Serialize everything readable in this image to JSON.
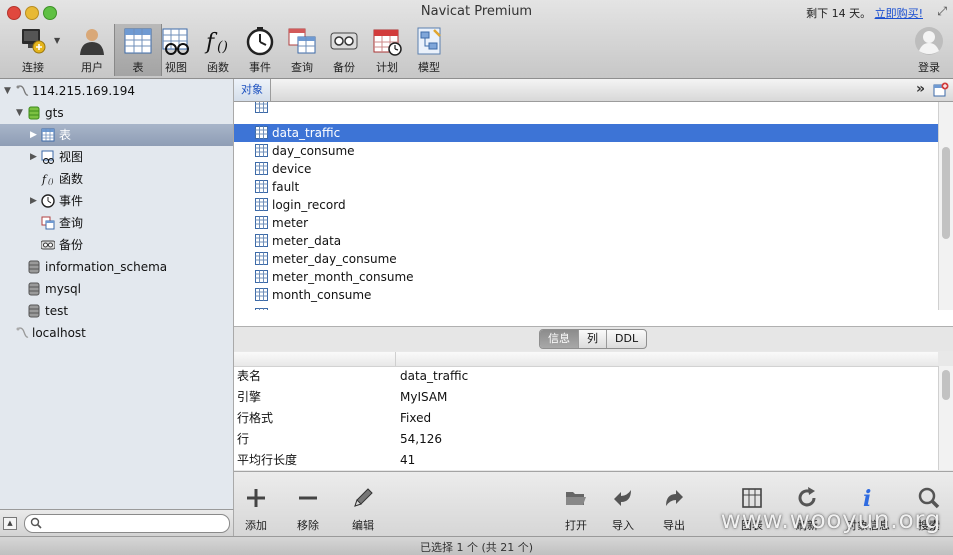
{
  "window": {
    "title": "Navicat Premium",
    "trial_text": "剩下 14 天。",
    "buy_link": "立即购买!"
  },
  "toolbar": [
    {
      "label": "连接",
      "icon": "connection-icon"
    },
    {
      "label": "用户",
      "icon": "user-icon"
    },
    {
      "label": "表",
      "icon": "table-icon"
    },
    {
      "label": "视图",
      "icon": "view-icon"
    },
    {
      "label": "函数",
      "icon": "function-icon"
    },
    {
      "label": "事件",
      "icon": "event-icon"
    },
    {
      "label": "查询",
      "icon": "query-icon"
    },
    {
      "label": "备份",
      "icon": "backup-icon"
    },
    {
      "label": "计划",
      "icon": "schedule-icon"
    },
    {
      "label": "模型",
      "icon": "model-icon"
    },
    {
      "label": "登录",
      "icon": "login-icon"
    }
  ],
  "sidebar": {
    "nodes": [
      {
        "label": "114.215.169.194"
      },
      {
        "label": "gts"
      },
      {
        "label": "表"
      },
      {
        "label": "视图"
      },
      {
        "label": "函数"
      },
      {
        "label": "事件"
      },
      {
        "label": "查询"
      },
      {
        "label": "备份"
      },
      {
        "label": "information_schema"
      },
      {
        "label": "mysql"
      },
      {
        "label": "test"
      },
      {
        "label": "localhost"
      }
    ]
  },
  "tab": {
    "objects_label": "对象"
  },
  "tables": [
    "data_traffic",
    "day_consume",
    "device",
    "fault",
    "login_record",
    "meter",
    "meter_data",
    "meter_day_consume",
    "meter_month_consume",
    "month_consume"
  ],
  "detail_tabs": [
    "信息",
    "列",
    "DDL"
  ],
  "info": [
    {
      "key": "表名",
      "value": "data_traffic"
    },
    {
      "key": "引擎",
      "value": "MyISAM"
    },
    {
      "key": "行格式",
      "value": "Fixed"
    },
    {
      "key": "行",
      "value": "54,126"
    },
    {
      "key": "平均行长度",
      "value": "41"
    }
  ],
  "bottom_toolbar": [
    {
      "label": "添加",
      "icon": "add-icon"
    },
    {
      "label": "移除",
      "icon": "remove-icon"
    },
    {
      "label": "编辑",
      "icon": "edit-icon"
    },
    {
      "label": "打开",
      "icon": "open-icon"
    },
    {
      "label": "导入",
      "icon": "import-icon"
    },
    {
      "label": "导出",
      "icon": "export-icon"
    },
    {
      "label": "图表",
      "icon": "chart-icon"
    },
    {
      "label": "刷新",
      "icon": "refresh-icon"
    },
    {
      "label": "对象信息",
      "icon": "info-icon"
    },
    {
      "label": "搜索",
      "icon": "search-icon"
    }
  ],
  "status": {
    "text": "已选择 1 个 (共 21 个)"
  },
  "watermark": "www.wooyun.org",
  "colors": {
    "selection": "#3d74d6",
    "sidebar_selection": "#9aa8bf",
    "link": "#1a4fd1"
  }
}
